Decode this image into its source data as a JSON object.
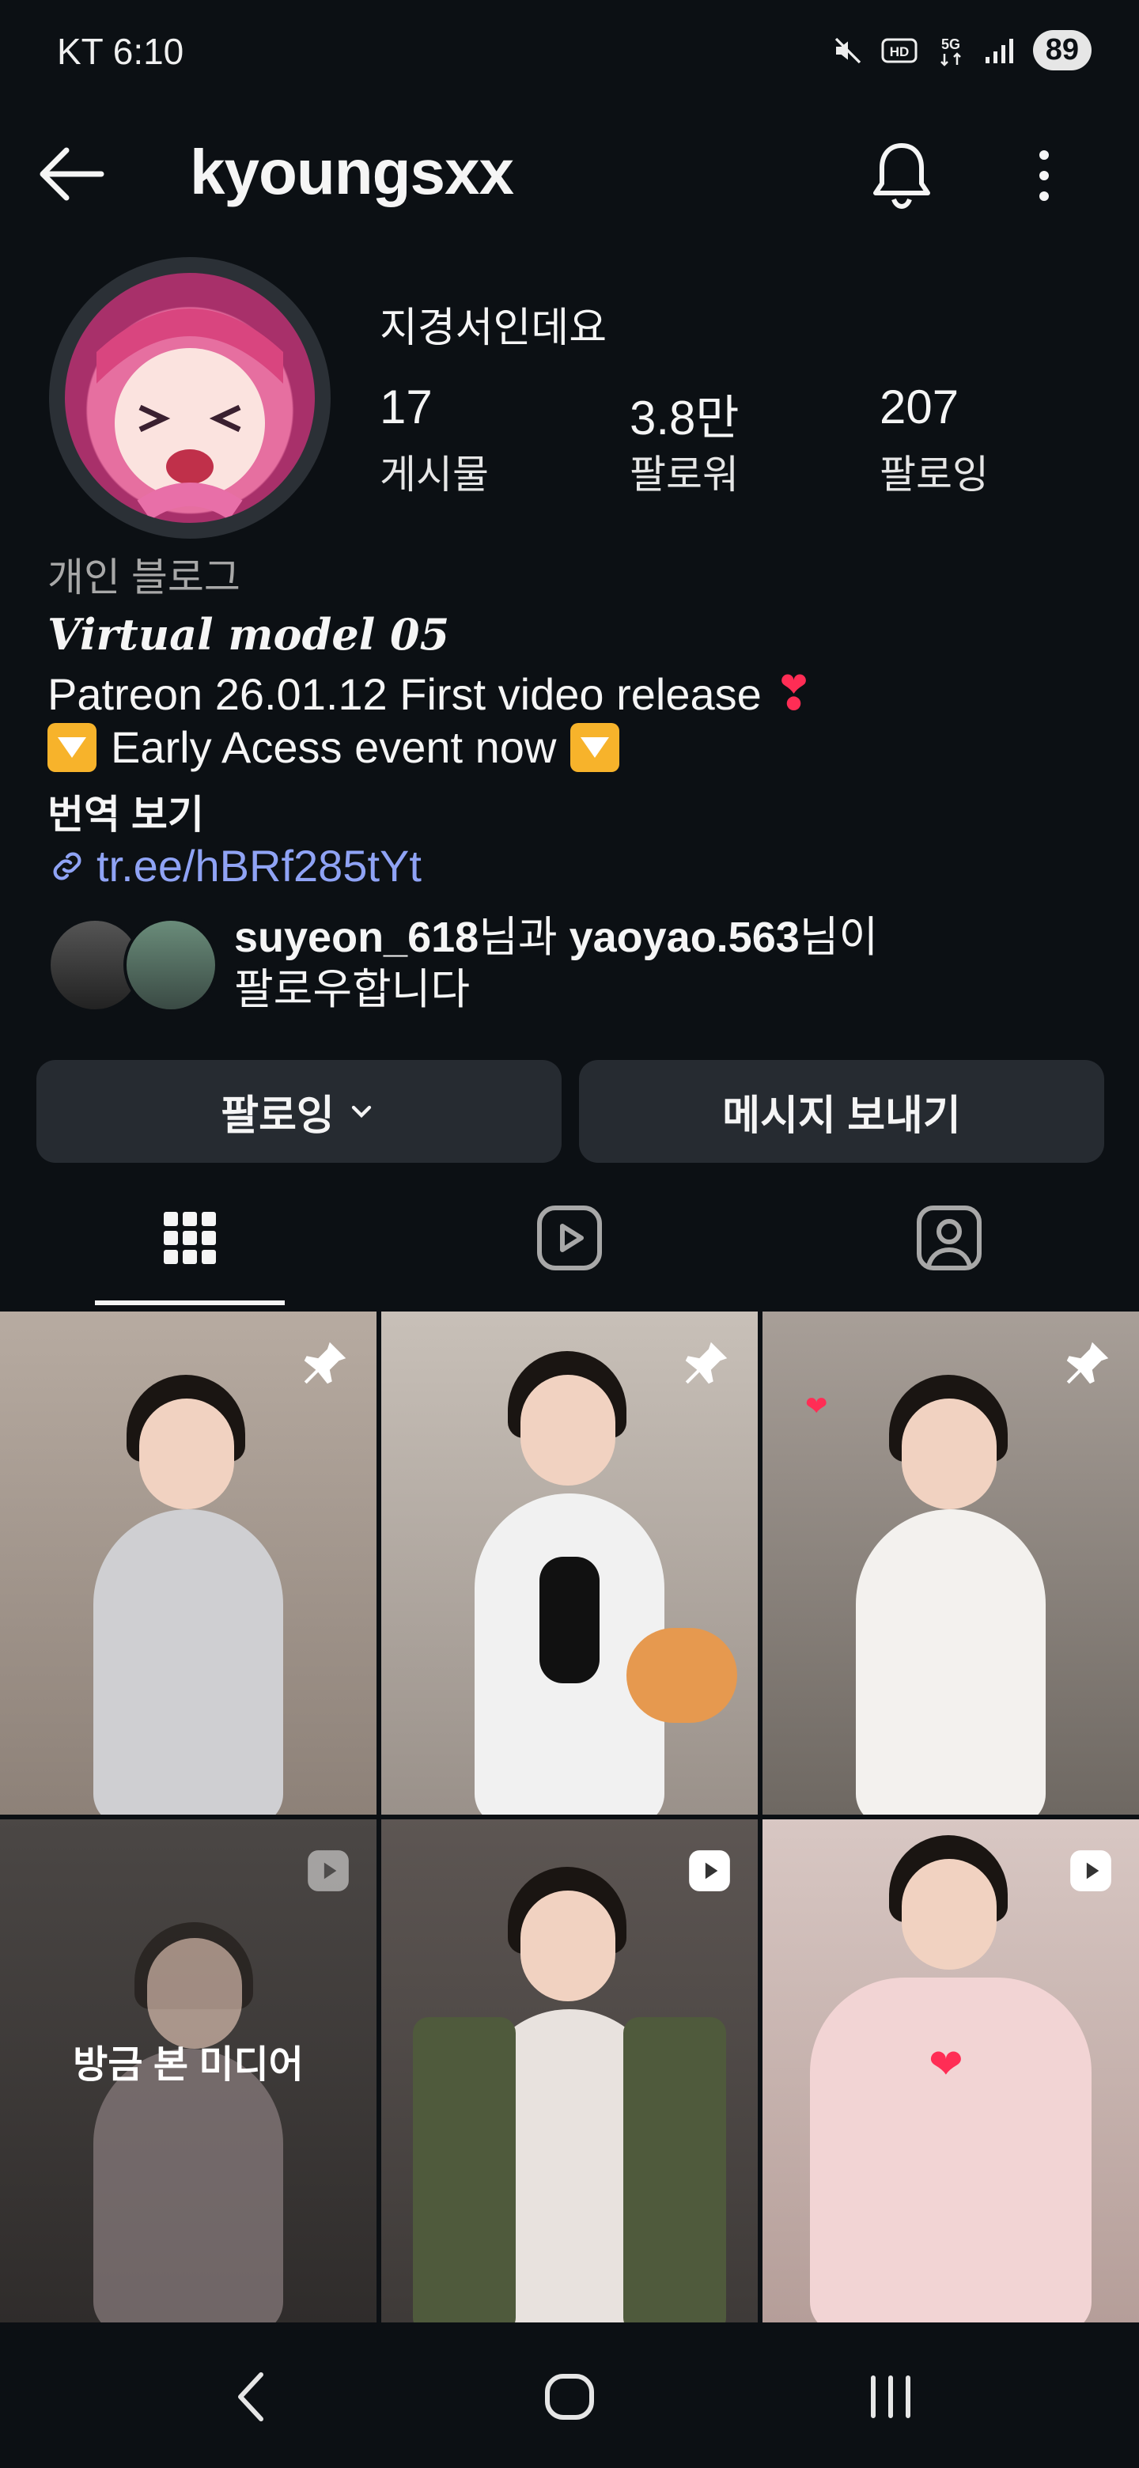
{
  "status_bar": {
    "carrier_time": "KT 6:10",
    "battery": "89",
    "icons": [
      "mute-icon",
      "hd-icon",
      "5g-icon",
      "signal-icon"
    ]
  },
  "header": {
    "username": "kyoungsxx",
    "icons": [
      "back-arrow-icon",
      "bell-icon",
      "more-vert-icon"
    ]
  },
  "profile": {
    "full_name": "지경서인데요",
    "stats": [
      {
        "value": "17",
        "label": "게시물"
      },
      {
        "value": "3.8만",
        "label": "팔로워"
      },
      {
        "value": "207",
        "label": "팔로잉"
      }
    ],
    "category": "개인 블로그",
    "bio_title": "Virtual model 05",
    "bio_line1": "Patreon 26.01.12 First video release",
    "bio_line2": "Early Acess event now",
    "translate": "번역 보기",
    "link": "tr.ee/hBRf285tYt",
    "followed_by_user1": "suyeon_618",
    "followed_by_mid": "님과",
    "followed_by_user2": "yaoyao.563",
    "followed_by_end": "님이",
    "followed_by_line2": "팔로우합니다"
  },
  "buttons": {
    "following": "팔로잉",
    "message": "메시지 보내기"
  },
  "tabs": [
    "grid-icon",
    "reels-icon",
    "tagged-icon"
  ],
  "grid": {
    "recently_viewed_label": "방금 본 미디어",
    "posts": [
      {
        "type": "pinned"
      },
      {
        "type": "pinned"
      },
      {
        "type": "pinned"
      },
      {
        "type": "reel"
      },
      {
        "type": "reel"
      },
      {
        "type": "reel"
      }
    ]
  },
  "colors": {
    "background": "#0c1014",
    "button": "#262b31",
    "link": "#8fa3f5",
    "heart": "#ff2d55",
    "muted": "#a8a8a8"
  }
}
